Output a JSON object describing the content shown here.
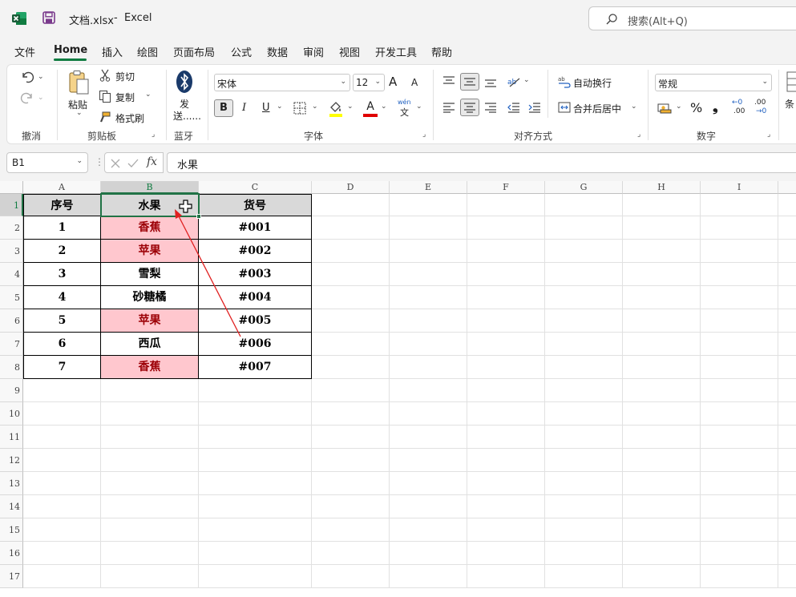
{
  "titlebar": {
    "filename": "文档.xlsx",
    "separator": "-",
    "app": "Excel",
    "search_placeholder": "搜索(Alt+Q)"
  },
  "menu": [
    {
      "label": "文件"
    },
    {
      "label": "Home"
    },
    {
      "label": "插入"
    },
    {
      "label": "绘图"
    },
    {
      "label": "页面布局"
    },
    {
      "label": "公式"
    },
    {
      "label": "数据"
    },
    {
      "label": "审阅"
    },
    {
      "label": "视图"
    },
    {
      "label": "开发工具"
    },
    {
      "label": "帮助"
    }
  ],
  "ribbon": {
    "groups": {
      "undo": "撤消",
      "clipboard": "剪贴板",
      "bluetooth": "蓝牙",
      "font": "字体",
      "align": "对齐方式",
      "number": "数字"
    },
    "clipboard": {
      "paste": "粘贴",
      "cut": "剪切",
      "copy": "复制",
      "format_painter": "格式刷"
    },
    "bluetooth": {
      "send_line1": "发",
      "send_line2": "送......"
    },
    "font": {
      "name": "宋体",
      "size": "12",
      "bold": "B",
      "italic": "I",
      "underline": "U",
      "grow": "A",
      "shrink": "A",
      "font_color_letter": "A",
      "phonetic_top": "wén",
      "phonetic_bottom": "文"
    },
    "align": {
      "wrap_text": "自动换行",
      "merge_center": "合并后居中"
    },
    "number": {
      "format": "常规",
      "percent": "%",
      "comma": "❟",
      "inc_decimal_top": "←0",
      "inc_decimal_bottom": ".00",
      "dec_decimal_top": ".00",
      "dec_decimal_bottom": "→0"
    },
    "cond_format_partial": "条"
  },
  "formula_bar": {
    "cell_ref": "B1",
    "fx": "fx",
    "value": "水果"
  },
  "colors": {
    "header_fill": "#d9d9d9",
    "highlight_fill": "#ffc7ce",
    "highlight_text": "#9c0006",
    "arrow": "#e02020",
    "selection": "#217346"
  },
  "sheet": {
    "columns": [
      "A",
      "B",
      "C",
      "D",
      "E",
      "F",
      "G",
      "H",
      "I"
    ],
    "rows": [
      "1",
      "2",
      "3",
      "4",
      "5",
      "6",
      "7",
      "8",
      "9",
      "10",
      "11",
      "12",
      "13",
      "14",
      "15",
      "16",
      "17"
    ],
    "table": [
      [
        "序号",
        "水果",
        "货号"
      ],
      [
        "1",
        "香蕉",
        "#001"
      ],
      [
        "2",
        "苹果",
        "#002"
      ],
      [
        "3",
        "雪梨",
        "#003"
      ],
      [
        "4",
        "砂糖橘",
        "#004"
      ],
      [
        "5",
        "苹果",
        "#005"
      ],
      [
        "6",
        "西瓜",
        "#006"
      ],
      [
        "7",
        "香蕉",
        "#007"
      ]
    ],
    "highlighted_rows": [
      1,
      2,
      5,
      7
    ],
    "selected_cell": "B1"
  }
}
